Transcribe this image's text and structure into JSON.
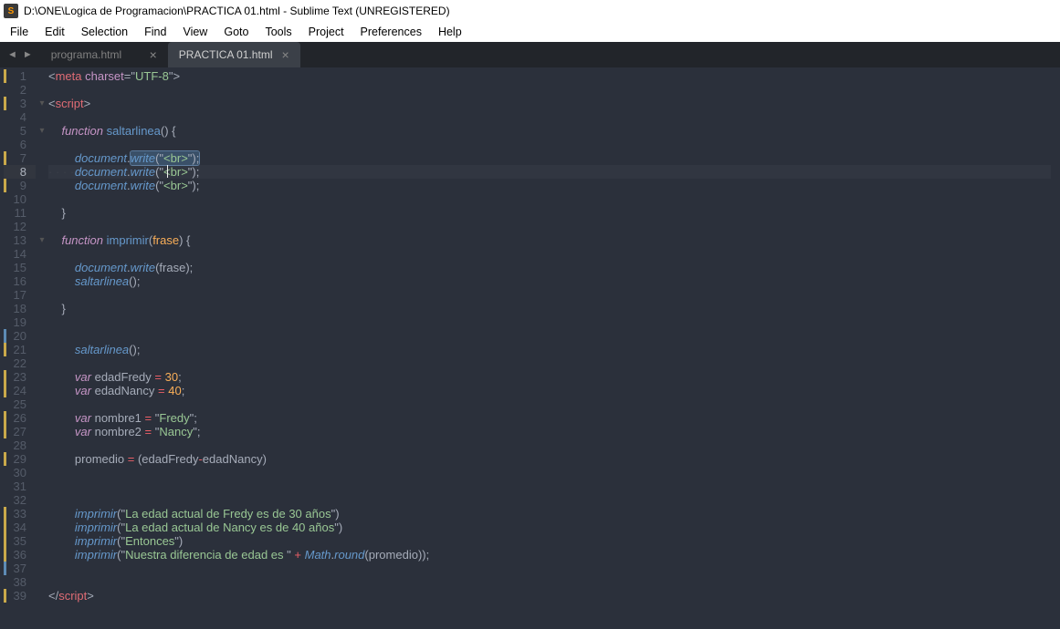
{
  "window": {
    "title": "D:\\ONE\\Logica de Programacion\\PRACTICA 01.html - Sublime Text (UNREGISTERED)",
    "icon_letter": "S"
  },
  "menu": {
    "file": "File",
    "edit": "Edit",
    "selection": "Selection",
    "find": "Find",
    "view": "View",
    "goto": "Goto",
    "tools": "Tools",
    "project": "Project",
    "preferences": "Preferences",
    "help": "Help"
  },
  "nav": {
    "back": "◄",
    "forward": "►"
  },
  "tabs": [
    {
      "label": "programa.html",
      "active": false,
      "close": "×"
    },
    {
      "label": "PRACTICA 01.html",
      "active": true,
      "close": "×"
    }
  ],
  "editor": {
    "active_line": 8,
    "line_count": 39,
    "marks_yellow": [
      1,
      3,
      7,
      9,
      21,
      23,
      24,
      26,
      27,
      29,
      33,
      34,
      35,
      36,
      39
    ],
    "marks_blue": [
      20,
      37
    ],
    "fold_markers": {
      "3": "▾",
      "5": "▾",
      "13": "▾"
    }
  },
  "code_tokens": {
    "l1": {
      "open": "<",
      "meta": "meta",
      "sp": " ",
      "attr": "charset",
      "eq": "=",
      "q": "\"",
      "val": "UTF-8",
      "close": ">"
    },
    "l3": {
      "open": "<",
      "script": "script",
      "close": ">"
    },
    "l5": {
      "fn": "function",
      "sp": " ",
      "name": "saltarlinea",
      "paren": "()",
      "ob": " {"
    },
    "l7": {
      "doc": "document",
      "dot": ".",
      "write": "write",
      "lp": "(",
      "q": "\"",
      "br": "<br>",
      "rp": ")",
      ";": ";"
    },
    "l8": {
      "doc": "document",
      "dot": ".",
      "write": "write",
      "lp": "(",
      "q": "\"",
      "br": "<br>",
      "rp": ")",
      ";": ";"
    },
    "l9": {
      "doc": "document",
      "dot": ".",
      "write": "write",
      "lp": "(",
      "q": "\"",
      "br": "<br>",
      "rp": ")",
      ";": ";"
    },
    "l11": {
      "cb": "}"
    },
    "l13": {
      "fn": "function",
      "sp": " ",
      "name": "imprimir",
      "lp": "(",
      "prm": "frase",
      "rp": ")",
      "ob": " {"
    },
    "l15": {
      "doc": "document",
      "dot": ".",
      "write": "write",
      "lp": "(",
      "frase": "frase",
      "rp": ")",
      ";": ";"
    },
    "l16": {
      "call": "saltarlinea",
      "paren": "()",
      ";": ";"
    },
    "l18": {
      "cb": "}"
    },
    "l21": {
      "call": "saltarlinea",
      "paren": "()",
      ";": ";"
    },
    "l23": {
      "var": "var",
      "sp": " ",
      "name": "edadFredy",
      "sp2": " ",
      "eq": "=",
      "sp3": " ",
      "num": "30",
      ";": ";"
    },
    "l24": {
      "var": "var",
      "sp": " ",
      "name": "edadNancy",
      "sp2": " ",
      "eq": "=",
      "sp3": " ",
      "num": "40",
      ";": ";"
    },
    "l26": {
      "var": "var",
      "sp": " ",
      "name": "nombre1",
      "sp2": " ",
      "eq": "=",
      "sp3": " ",
      "q": "\"",
      "str": "Fredy",
      ";": ";"
    },
    "l27": {
      "var": "var",
      "sp": " ",
      "name": "nombre2",
      "sp2": " ",
      "eq": "=",
      "sp3": " ",
      "q": "\"",
      "str": "Nancy",
      ";": ";"
    },
    "l29": {
      "name": "promedio",
      "sp": " ",
      "eq": "=",
      "sp2": " ",
      "lp": "(",
      "a": "edadFredy",
      "op": "-",
      "b": "edadNancy",
      "rp": ")"
    },
    "l33": {
      "call": "imprimir",
      "lp": "(",
      "q": "\"",
      "str": "La edad actual de Fredy es de 30 años",
      "rp": ")"
    },
    "l34": {
      "call": "imprimir",
      "lp": "(",
      "q": "\"",
      "str": "La edad actual de Nancy es de 40 años",
      "rp": ")"
    },
    "l35": {
      "call": "imprimir",
      "lp": "(",
      "q": "\"",
      "str": "Entonces",
      "rp": ")"
    },
    "l36": {
      "call": "imprimir",
      "lp": "(",
      "q": "\"",
      "str": "Nuestra diferencia de edad es ",
      "plus": " + ",
      "math": "Math",
      "dot": ".",
      "round": "round",
      "lp2": "(",
      "prm": "promedio",
      "rp2": ")",
      "rp": ")",
      ";": ";"
    },
    "l39": {
      "open": "<",
      "slash": "/",
      "script": "script",
      "close": ">"
    }
  }
}
